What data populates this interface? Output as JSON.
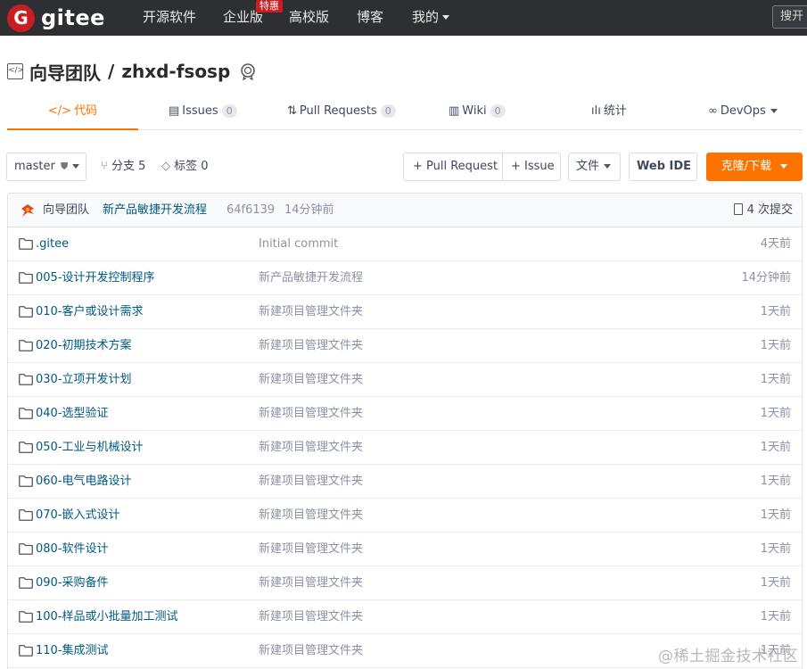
{
  "nav": {
    "logo_text": "gitee",
    "logo_mark": "G",
    "items": [
      {
        "label": "开源软件"
      },
      {
        "label": "企业版",
        "badge": "特惠"
      },
      {
        "label": "高校版"
      },
      {
        "label": "博客"
      },
      {
        "label": "我的"
      }
    ],
    "search_placeholder": "搜开"
  },
  "repo": {
    "owner": "向导团队",
    "separator": "/",
    "name": "zhxd-fsosp",
    "icon": "code-repo-icon"
  },
  "tabs": [
    {
      "label": "代码",
      "icon": "code-icon",
      "active": true
    },
    {
      "label": "Issues",
      "icon": "issues-icon",
      "count": "0"
    },
    {
      "label": "Pull Requests",
      "icon": "pull-request-icon",
      "count": "0"
    },
    {
      "label": "Wiki",
      "icon": "wiki-icon",
      "count": "0"
    },
    {
      "label": "统计",
      "icon": "stats-icon"
    },
    {
      "label": "DevOps",
      "icon": "devops-icon"
    }
  ],
  "toolbar": {
    "branch": "master",
    "branches_label": "分支 5",
    "tags_label": "标签 0",
    "pull_request_btn": "+ Pull Request",
    "issue_btn": "+ Issue",
    "file_btn": "文件",
    "webide_btn": "Web IDE",
    "clone_btn": "克隆/下载"
  },
  "last_commit": {
    "author": "向导团队",
    "message": "新产品敏捷开发流程",
    "sha": "64f6139",
    "time": "14分钟前",
    "commits_label": "4 次提交"
  },
  "files": [
    {
      "name": ".gitee",
      "message": "Initial commit",
      "time": "4天前"
    },
    {
      "name": "005-设计开发控制程序",
      "message": "新产品敏捷开发流程",
      "time": "14分钟前"
    },
    {
      "name": "010-客户或设计需求",
      "message": "新建项目管理文件夹",
      "time": "1天前"
    },
    {
      "name": "020-初期技术方案",
      "message": "新建项目管理文件夹",
      "time": "1天前"
    },
    {
      "name": "030-立项开发计划",
      "message": "新建项目管理文件夹",
      "time": "1天前"
    },
    {
      "name": "040-选型验证",
      "message": "新建项目管理文件夹",
      "time": "1天前"
    },
    {
      "name": "050-工业与机械设计",
      "message": "新建项目管理文件夹",
      "time": "1天前"
    },
    {
      "name": "060-电气电路设计",
      "message": "新建项目管理文件夹",
      "time": "1天前"
    },
    {
      "name": "070-嵌入式设计",
      "message": "新建项目管理文件夹",
      "time": "1天前"
    },
    {
      "name": "080-软件设计",
      "message": "新建项目管理文件夹",
      "time": "1天前"
    },
    {
      "name": "090-采购备件",
      "message": "新建项目管理文件夹",
      "time": "1天前"
    },
    {
      "name": "100-样品或小批量加工测试",
      "message": "新建项目管理文件夹",
      "time": "1天前"
    },
    {
      "name": "110-集成测试",
      "message": "新建项目管理文件夹",
      "time": "1天前"
    }
  ],
  "watermark": "@稀土掘金技术社区",
  "colors": {
    "nav_bg": "#2e2f33",
    "brand_red": "#c71d23",
    "accent_orange": "#fe7300",
    "link_blue": "#005980",
    "muted": "#8c92a4"
  }
}
